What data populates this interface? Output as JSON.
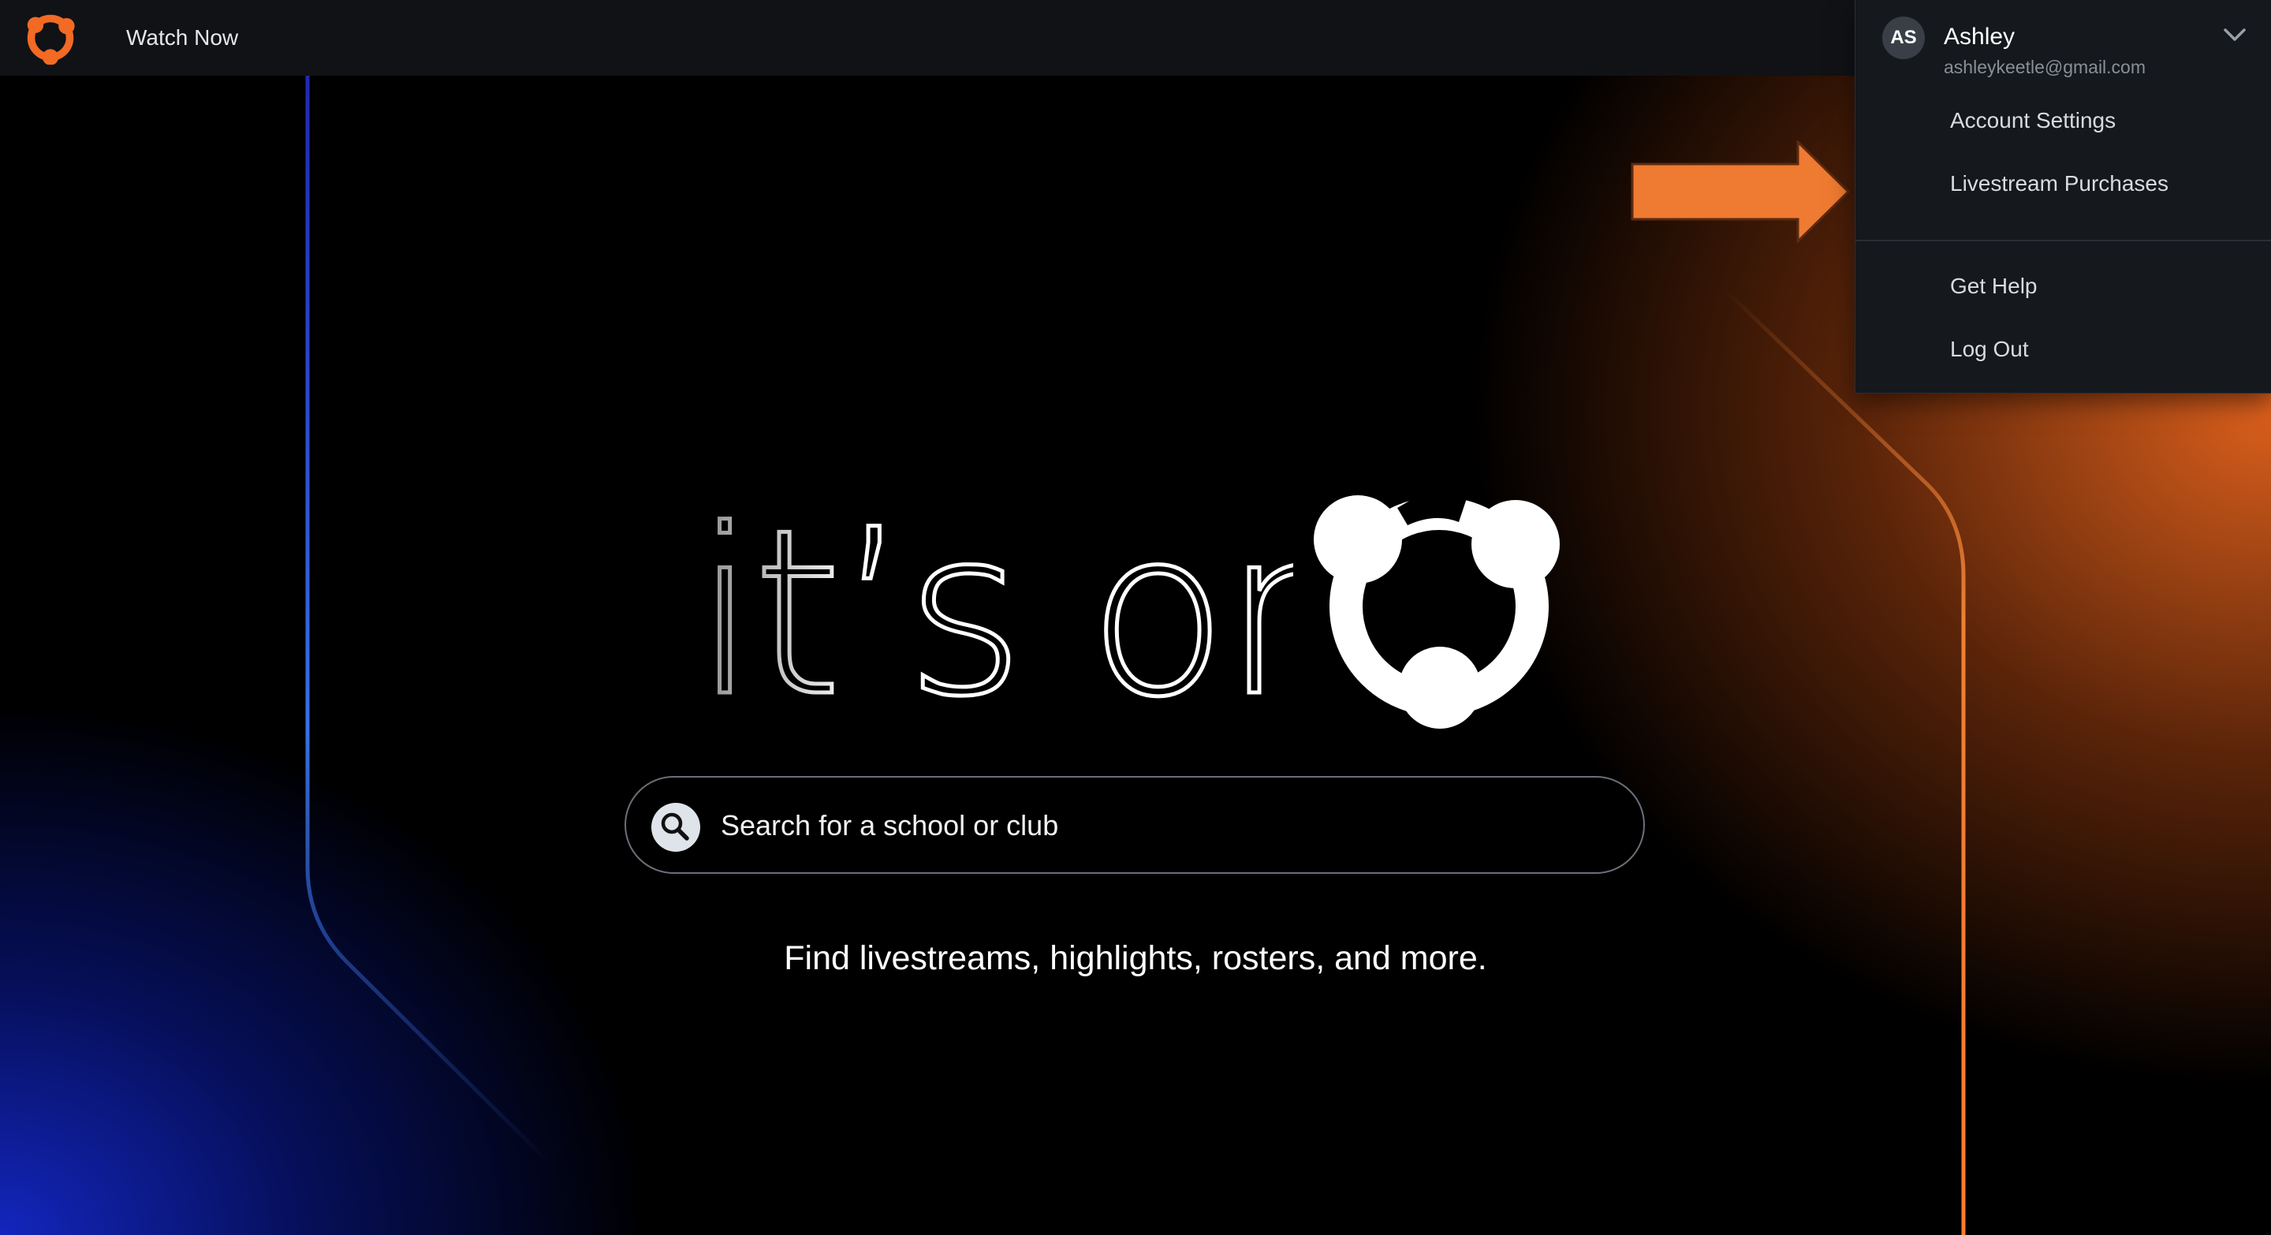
{
  "nav": {
    "logo_icon": "hudl-logo-icon",
    "watch_now": "Watch Now"
  },
  "account_menu": {
    "initials": "AS",
    "name": "Ashley",
    "email": "ashleykeetle@gmail.com",
    "chevron_icon": "chevron-down-icon",
    "items": [
      {
        "label": "Account Settings"
      },
      {
        "label": "Livestream Purchases"
      },
      {
        "label": "Get Help"
      },
      {
        "label": "Log Out"
      }
    ]
  },
  "hero": {
    "wordmark": "it’s on",
    "search_placeholder": "Search for a school or club",
    "search_icon": "search-icon",
    "subtitle": "Find livestreams, highlights, rosters, and more."
  },
  "annotation": {
    "arrow_icon": "arrow-right-icon",
    "color": "#ef7a31"
  },
  "colors": {
    "brand_orange": "#f26a24",
    "nav_bg": "#101216",
    "menu_bg": "#15181d"
  }
}
